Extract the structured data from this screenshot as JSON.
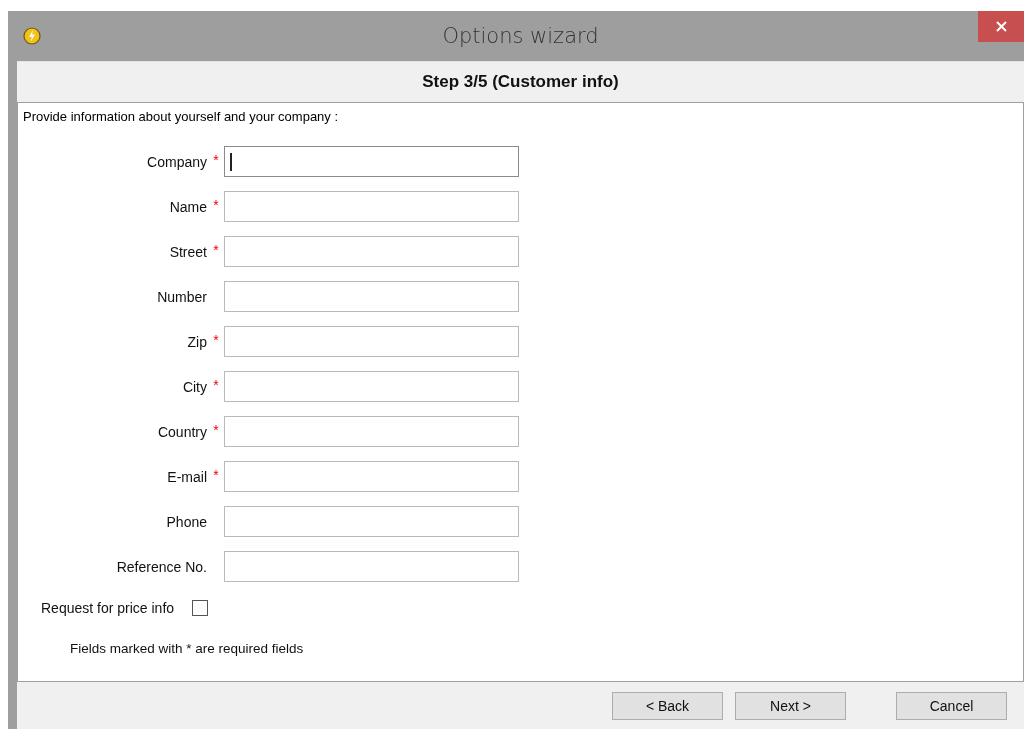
{
  "window": {
    "title": "Options wizard"
  },
  "step_header": "Step 3/5 (Customer info)",
  "intro": "Provide information about yourself and your company :",
  "fields": [
    {
      "label": "Company",
      "required_mark": "*",
      "focused": true
    },
    {
      "label": "Name",
      "required_mark": "*",
      "focused": false
    },
    {
      "label": "Street",
      "required_mark": "*",
      "focused": false
    },
    {
      "label": "Number",
      "focused": false
    },
    {
      "label": "Zip",
      "required_mark": "*",
      "focused": false
    },
    {
      "label": "City",
      "required_mark": "*",
      "focused": false
    },
    {
      "label": "Country",
      "required_mark": "*",
      "focused": false
    },
    {
      "label": "E-mail",
      "required_mark": "*",
      "focused": false
    },
    {
      "label": "Phone",
      "focused": false
    },
    {
      "label": "Reference No.",
      "focused": false
    }
  ],
  "price_info": {
    "label": "Request for price info",
    "checked": false
  },
  "footnote": "Fields marked with * are required fields",
  "buttons": [
    "< Back",
    "Next >",
    "Cancel"
  ]
}
